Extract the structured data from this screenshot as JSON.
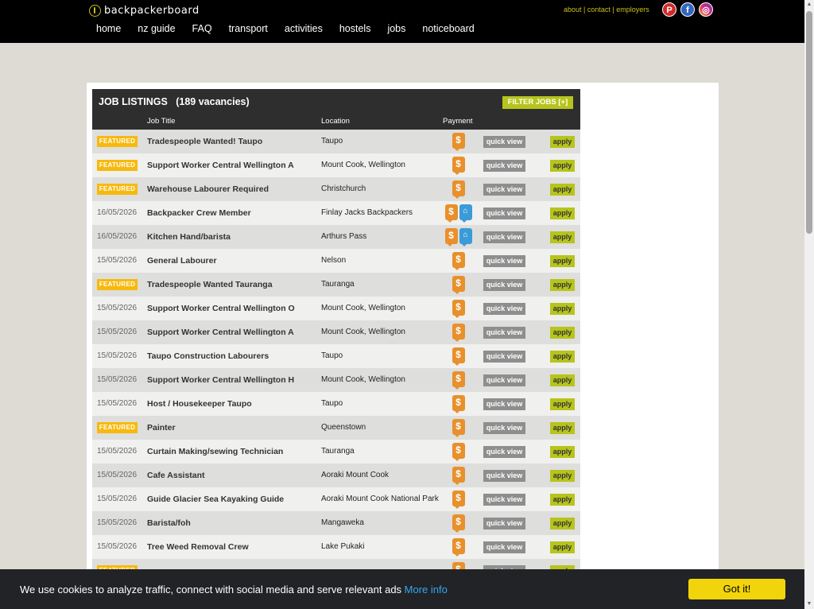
{
  "site": {
    "logo": "backpackerboard",
    "nav": [
      "home",
      "nz guide",
      "FAQ",
      "transport",
      "activities",
      "hostels",
      "jobs",
      "noticeboard"
    ],
    "top_links": [
      "about",
      "contact",
      "employers"
    ],
    "top_link_separator": " | "
  },
  "listing": {
    "title": "JOB LISTINGS   (189 vacancies)",
    "filter_label": "FILTER JOBS [+]",
    "columns": {
      "title": "Job Title",
      "location": "Location",
      "payment": "Payment"
    },
    "quick_view_label": "quick view",
    "apply_label": "apply",
    "featured_label": "FEATURED",
    "rows": [
      {
        "date": "",
        "featured": true,
        "title": "Tradespeople Wanted! Taupo",
        "location": "Taupo",
        "accommodation": false
      },
      {
        "date": "",
        "featured": true,
        "title": "Support Worker Central Wellington A",
        "location": "Mount Cook, Wellington",
        "accommodation": false
      },
      {
        "date": "",
        "featured": true,
        "title": "Warehouse Labourer Required",
        "location": "Christchurch",
        "accommodation": false
      },
      {
        "date": "16/05/2026",
        "featured": false,
        "title": "Backpacker Crew Member",
        "location": "Finlay Jacks Backpackers",
        "accommodation": true
      },
      {
        "date": "16/05/2026",
        "featured": false,
        "title": "Kitchen Hand/barista",
        "location": "Arthurs Pass",
        "accommodation": true
      },
      {
        "date": "15/05/2026",
        "featured": false,
        "title": "General Labourer",
        "location": "Nelson",
        "accommodation": false
      },
      {
        "date": "",
        "featured": true,
        "title": "Tradespeople Wanted Tauranga",
        "location": "Tauranga",
        "accommodation": false
      },
      {
        "date": "15/05/2026",
        "featured": false,
        "title": "Support Worker Central Wellington O",
        "location": "Mount Cook, Wellington",
        "accommodation": false
      },
      {
        "date": "15/05/2026",
        "featured": false,
        "title": "Support Worker Central Wellington A",
        "location": "Mount Cook, Wellington",
        "accommodation": false
      },
      {
        "date": "15/05/2026",
        "featured": false,
        "title": "Taupo Construction Labourers",
        "location": "Taupo",
        "accommodation": false
      },
      {
        "date": "15/05/2026",
        "featured": false,
        "title": "Support Worker Central Wellington H",
        "location": "Mount Cook, Wellington",
        "accommodation": false
      },
      {
        "date": "15/05/2026",
        "featured": false,
        "title": "Host / Housekeeper Taupo",
        "location": "Taupo",
        "accommodation": false
      },
      {
        "date": "",
        "featured": true,
        "title": "Painter",
        "location": "Queenstown",
        "accommodation": false
      },
      {
        "date": "15/05/2026",
        "featured": false,
        "title": "Curtain Making/sewing Technician",
        "location": "Tauranga",
        "accommodation": false
      },
      {
        "date": "15/05/2026",
        "featured": false,
        "title": "Cafe Assistant",
        "location": "Aoraki Mount Cook",
        "accommodation": false
      },
      {
        "date": "15/05/2026",
        "featured": false,
        "title": "Guide Glacier Sea Kayaking Guide",
        "location": "Aoraki Mount Cook National Park",
        "accommodation": false
      },
      {
        "date": "15/05/2026",
        "featured": false,
        "title": "Barista/foh",
        "location": "Mangaweka",
        "accommodation": false
      },
      {
        "date": "15/05/2026",
        "featured": false,
        "title": "Tree Weed Removal Crew",
        "location": "Lake Pukaki",
        "accommodation": false
      },
      {
        "date": "",
        "featured": true,
        "title": "",
        "location": "",
        "accommodation": false
      }
    ]
  },
  "cookie": {
    "text": "We use cookies to analyze traffic, connect with social media and serve relevant ads ",
    "link": "More info",
    "button": "Got it!"
  }
}
